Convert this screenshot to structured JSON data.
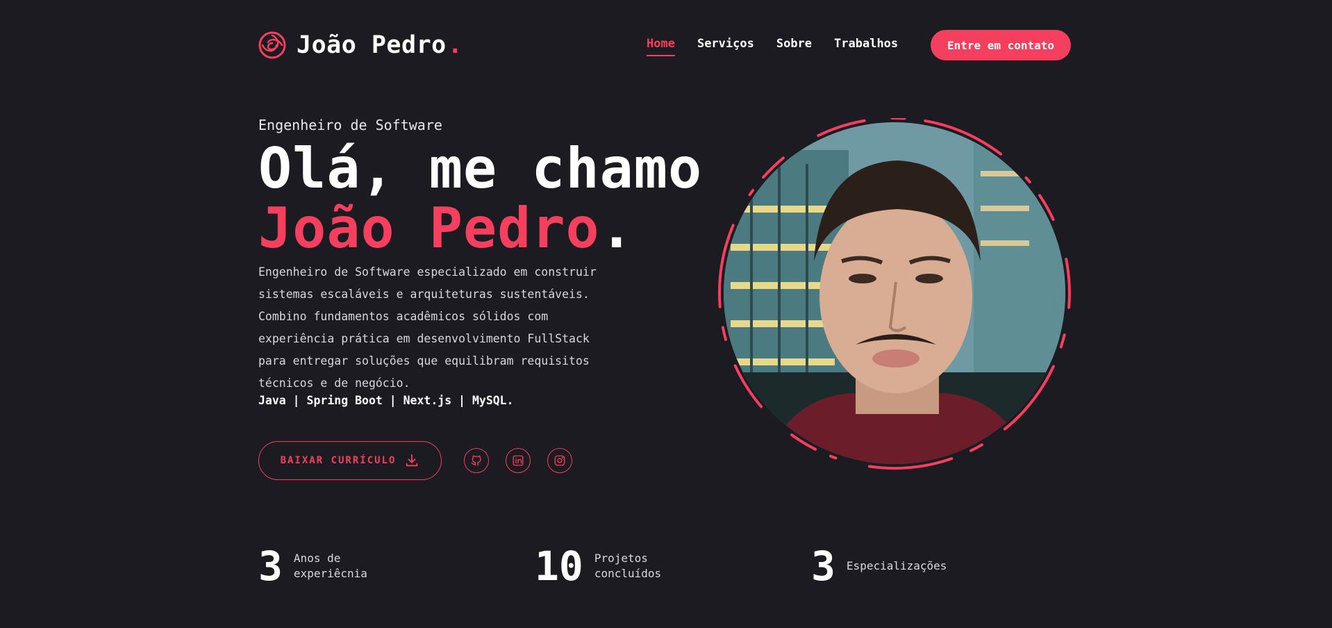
{
  "brand": {
    "name": "João Pedro",
    "dot": ".",
    "icon": "spiral-logo-icon",
    "accent": "#f43f5e"
  },
  "nav": {
    "items": [
      {
        "label": "Home",
        "active": true
      },
      {
        "label": "Serviços",
        "active": false
      },
      {
        "label": "Sobre",
        "active": false
      },
      {
        "label": "Trabalhos",
        "active": false
      }
    ],
    "cta_label": "Entre em contato"
  },
  "hero": {
    "eyebrow": "Engenheiro de Software",
    "title_line1": "Olá, me chamo",
    "title_name": "João Pedro",
    "title_dot": ".",
    "description_lines": [
      "Engenheiro de Software especializado em construir",
      "sistemas escaláveis e arquiteturas sustentáveis.",
      "Combino fundamentos acadêmicos sólidos com",
      "experiência prática em desenvolvimento FullStack",
      "para entregar soluções que equilibram requisitos",
      "técnicos e de negócio."
    ],
    "stack": "Java | Spring Boot | Next.js | MySQL.",
    "cv_button": "BAIXAR CURRÍCULO",
    "socials": [
      "github-icon",
      "linkedin-icon",
      "instagram-icon"
    ]
  },
  "stats": [
    {
      "value": "3",
      "label": "Anos de\nexperiêcnia"
    },
    {
      "value": "10",
      "label": "Projetos\nconcluídos"
    },
    {
      "value": "3",
      "label": "Especializações"
    }
  ],
  "colors": {
    "background": "#1c1b22",
    "accent": "#f43f5e",
    "text": "#ffffff"
  }
}
